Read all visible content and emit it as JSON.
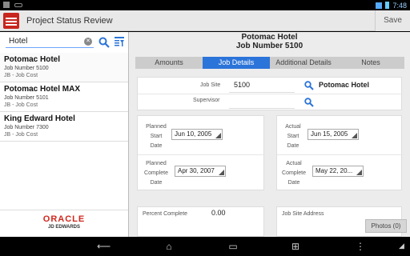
{
  "statusbar": {
    "time": "7:48"
  },
  "actionbar": {
    "title": "Project Status Review",
    "save_label": "Save"
  },
  "search": {
    "value": "Hotel"
  },
  "jobs": [
    {
      "name": "Potomac Hotel",
      "number": "Job Number 5100",
      "type": "JB - Job Cost"
    },
    {
      "name": "Potomac Hotel MAX",
      "number": "Job Number 5101",
      "type": "JB - Job Cost"
    },
    {
      "name": "King Edward Hotel",
      "number": "Job Number 7300",
      "type": "JB - Job Cost"
    }
  ],
  "branding": {
    "company": "ORACLE",
    "product": "JD EDWARDS"
  },
  "detail": {
    "title": "Potomac Hotel",
    "subtitle": "Job Number 5100",
    "tabs": [
      "Amounts",
      "Job Details",
      "Additional Details",
      "Notes"
    ],
    "active_tab": "Job Details",
    "job_site_label": "Job Site",
    "job_site_value": "5100",
    "job_site_name": "Potomac Hotel",
    "supervisor_label": "Supervisor",
    "supervisor_value": "",
    "planned_start_label": [
      "Planned",
      "Start",
      "Date"
    ],
    "planned_start_value": "Jun 10, 2005",
    "actual_start_label": [
      "Actual",
      "Start",
      "Date"
    ],
    "actual_start_value": "Jun 15, 2005",
    "planned_complete_label": [
      "Planned",
      "Complete",
      "Date"
    ],
    "planned_complete_value": "Apr 30, 2007",
    "actual_complete_label": [
      "Actual",
      "Complete",
      "Date"
    ],
    "actual_complete_value": "May 22, 20...",
    "percent_complete_label": "Percent Complete",
    "percent_complete_value": "0.00",
    "address_label": "Job Site Address",
    "photos_label": "Photos (0)"
  },
  "colors": {
    "accent": "#2b74d9",
    "brand": "#d0271d"
  }
}
